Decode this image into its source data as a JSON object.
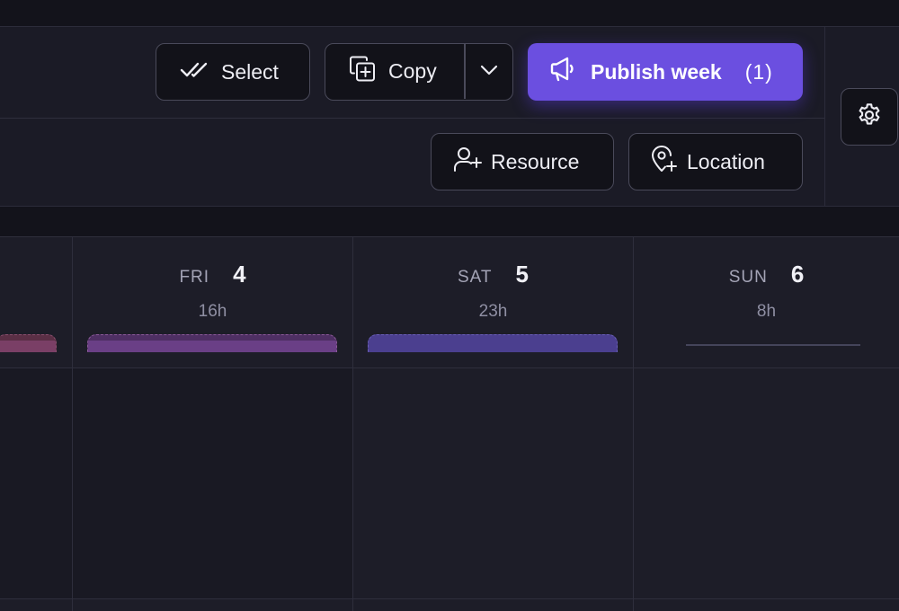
{
  "toolbar": {
    "select_label": "Select",
    "copy_label": "Copy",
    "publish_label": "Publish week",
    "publish_count": "(1)",
    "resource_label": "Resource",
    "location_label": "Location"
  },
  "icons": {
    "select": "double-check-icon",
    "copy": "copy-plus-icon",
    "copy_menu": "chevron-down-icon",
    "publish": "megaphone-icon",
    "resource": "user-plus-icon",
    "location": "map-pin-plus-icon",
    "settings": "gear-icon"
  },
  "colors": {
    "accent": "#6b4fe0",
    "bar_red": "#7a3f66",
    "bar_purple": "#6a3f86",
    "bar_indigo": "#4b3f8f"
  },
  "calendar": {
    "days": [
      {
        "name": "",
        "number": "",
        "hours": "",
        "bar": "red"
      },
      {
        "name": "FRI",
        "number": "4",
        "hours": "16h",
        "bar": "purple"
      },
      {
        "name": "SAT",
        "number": "5",
        "hours": "23h",
        "bar": "indigo"
      },
      {
        "name": "SUN",
        "number": "6",
        "hours": "8h",
        "bar": "none"
      }
    ]
  }
}
